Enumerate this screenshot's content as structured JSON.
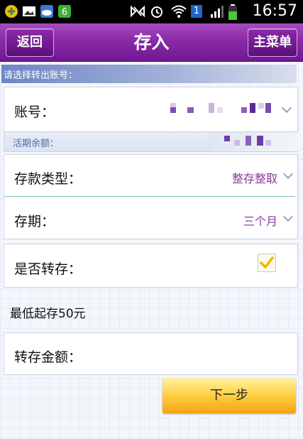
{
  "status_bar": {
    "time": "16:57",
    "signal_badge": "1"
  },
  "header": {
    "title": "存入",
    "back_label": "返回",
    "menu_label": "主菜单"
  },
  "section": {
    "label": "请选择转出账号："
  },
  "account": {
    "label": "账号：",
    "balance_label": "活期余额："
  },
  "deposit_type": {
    "label": "存款类型：",
    "value": "整存整取"
  },
  "term": {
    "label": "存期：",
    "value": "三个月"
  },
  "auto_renew": {
    "label": "是否转存：",
    "checked": true
  },
  "minimum_note": "最低起存50元",
  "amount": {
    "label": "转存金额："
  },
  "next_button": "下一步",
  "colors": {
    "titlebar": "#8a2aa8",
    "accent_value": "#8a3aa0",
    "next_button": "#ffd34a"
  }
}
